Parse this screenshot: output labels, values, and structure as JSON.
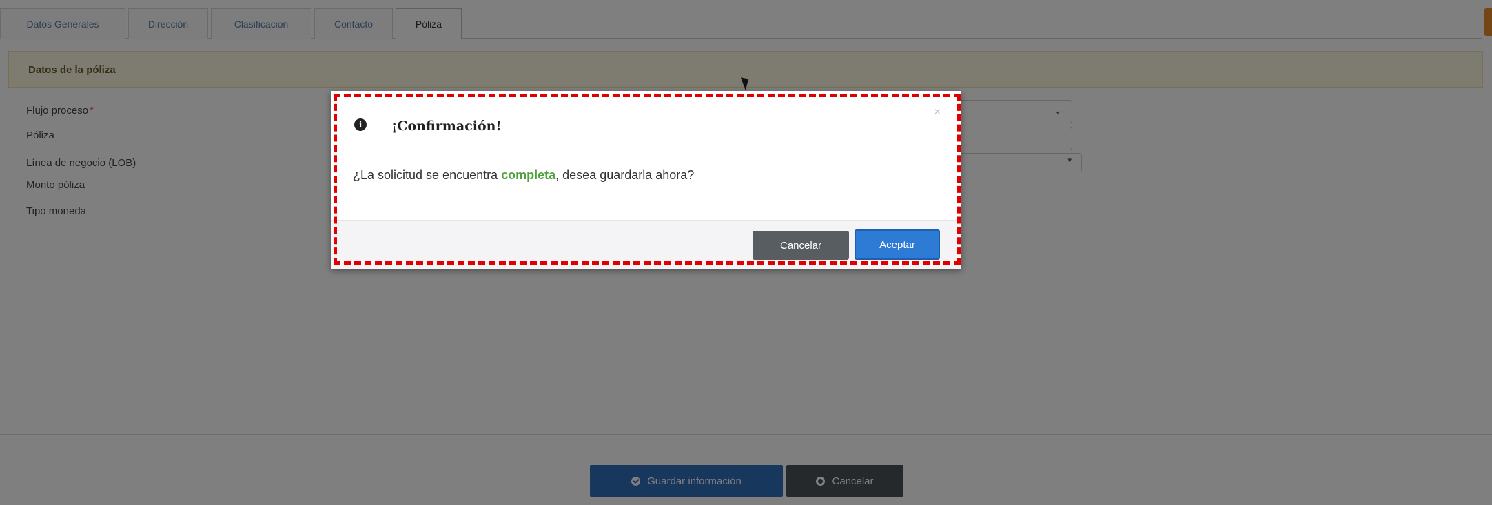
{
  "tabs": [
    "Datos Generales",
    "Dirección",
    "Clasificación",
    "Contacto",
    "Póliza"
  ],
  "active_tab": "Póliza",
  "panel": {
    "title": "Datos de la póliza"
  },
  "fields": {
    "flujo": "Flujo proceso",
    "poliza": "Póliza",
    "linea": "Línea de negocio (LOB)",
    "monto": "Monto póliza",
    "moneda": "Tipo moneda"
  },
  "footer": {
    "save_label": "Guardar información",
    "cancel_label": "Cancelar"
  },
  "modal": {
    "title": "¡Confirmación!",
    "close": "×",
    "message_before": "¿La solicitud se encuentra ",
    "message_highlight": "completa",
    "message_after": ", desea guardarla ahora?",
    "cancel_label": "Cancelar",
    "accept_label": "Aceptar"
  },
  "colors": {
    "primary": "#2e7bd6",
    "highlight_green": "#4fa23a",
    "annotation_red": "#e00000"
  }
}
